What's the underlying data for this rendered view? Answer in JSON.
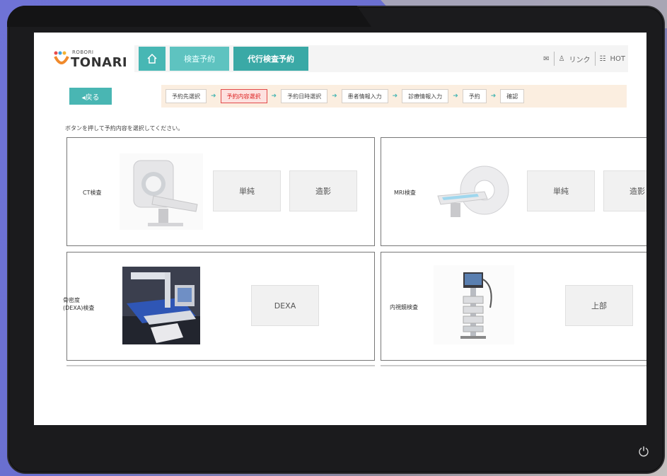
{
  "app": {
    "logo_small": "ROBORI",
    "logo_name": "TONARI"
  },
  "nav": {
    "home_icon": "home-icon",
    "tabs": [
      {
        "label": "検査予約"
      },
      {
        "label": "代行検査予約"
      }
    ]
  },
  "header_right": {
    "mail_icon": "mail-icon",
    "user_label": "リンク",
    "menu_label": "HOT"
  },
  "back_button": "◂戻る",
  "steps": [
    {
      "label": "予約先選択"
    },
    {
      "label": "予約内容選択"
    },
    {
      "label": "予約日時選択"
    },
    {
      "label": "患者情報入力"
    },
    {
      "label": "診療情報入力"
    },
    {
      "label": "予約"
    },
    {
      "label": "確認"
    }
  ],
  "instruction": "ボタンを押して予約内容を選択してください。",
  "exams": [
    {
      "name": "CT検査",
      "options": [
        "単純",
        "造影"
      ]
    },
    {
      "name": "MRI検査",
      "options": [
        "単純",
        "造影"
      ]
    },
    {
      "name": "骨密度(DEXA)検査",
      "options": [
        "DEXA"
      ]
    },
    {
      "name": "内視鏡検査",
      "options": [
        "上部"
      ]
    }
  ],
  "colors": {
    "teal": "#49b6b3",
    "teal_dark": "#3aa9a6",
    "stepper_bg": "#fbeee0",
    "current_step": "#e24a4a"
  },
  "device": {
    "power_icon": "power-icon"
  }
}
